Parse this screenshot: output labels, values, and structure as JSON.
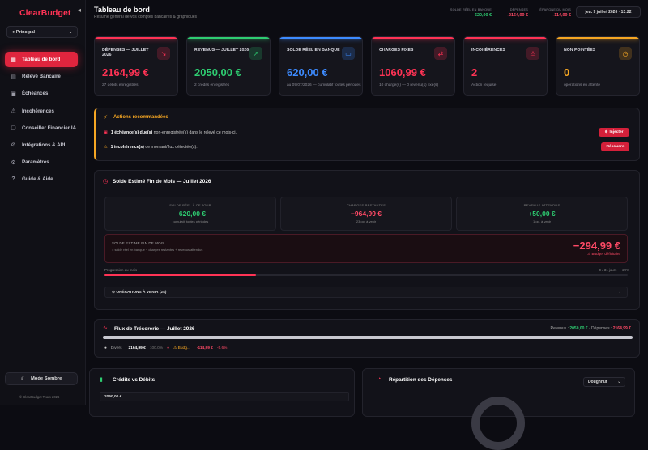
{
  "app": {
    "brand": "ClearBudget",
    "workspace": "● Principal",
    "dark_mode": "Mode Sombre",
    "copyright": "© ClearBudget Team 2026"
  },
  "nav": [
    {
      "label": "Tableau de bord",
      "icon": "grid-icon",
      "active": true
    },
    {
      "label": "Relevé Bancaire",
      "icon": "bank-icon"
    },
    {
      "label": "Échéances",
      "icon": "calendar-icon"
    },
    {
      "label": "Incohérences",
      "icon": "alert-icon"
    },
    {
      "label": "Conseiller Financier IA",
      "icon": "chat-icon"
    },
    {
      "label": "Intégrations & API",
      "icon": "link-icon"
    },
    {
      "label": "Paramètres",
      "icon": "gear-icon"
    },
    {
      "label": "Guide & Aide",
      "icon": "help-icon"
    }
  ],
  "header": {
    "title": "Tableau de bord",
    "subtitle": "Résumé général de vos comptes bancaires & graphiques",
    "stats": [
      {
        "label": "SOLDE RÉEL EN BANQUE",
        "value": "620,00 €",
        "color": "#2ecc71"
      },
      {
        "label": "DÉPENSES",
        "value": "-2164,99 €",
        "color": "#ff4a66"
      },
      {
        "label": "ÉPARGNE DU MOIS",
        "value": "-114,99 €",
        "color": "#ff4a66"
      }
    ],
    "date": "jeu. 9 juillet 2026 · 13:22"
  },
  "kpis": [
    {
      "label": "DÉPENSES — JUILLET 2026",
      "value": "2164,99 €",
      "sub": "27 débits enregistrés",
      "color": "#ff3355",
      "icon": "trend-down-icon",
      "glyph": "↘"
    },
    {
      "label": "REVENUS — JUILLET 2026",
      "value": "2050,00 €",
      "sub": "2 crédits enregistrés",
      "color": "#2ecc71",
      "icon": "trend-up-icon",
      "glyph": "↗"
    },
    {
      "label": "SOLDE RÉEL EN BANQUE",
      "value": "620,00 €",
      "sub": "au 09/07/2026 — cumulatif toutes périodes",
      "color": "#3d8bff",
      "icon": "wallet-icon",
      "glyph": "▭"
    },
    {
      "label": "CHARGES FIXES",
      "value": "1060,99 €",
      "sub": "10 charge(s) — 0 revenu(s) fixe(s)",
      "color": "#ff3355",
      "icon": "repeat-icon",
      "glyph": "⇄"
    },
    {
      "label": "INCOHÉRENCES",
      "value": "2",
      "sub": "Action requise",
      "color": "#ff3355",
      "icon": "warning-icon",
      "glyph": "⚠"
    },
    {
      "label": "NON POINTÉES",
      "value": "0",
      "sub": "opérations en attente",
      "color": "#f5a623",
      "icon": "clock-icon",
      "glyph": "◷"
    }
  ],
  "actions": {
    "title": "Actions recommandées",
    "rows": [
      {
        "bold": "1 échéance(s) due(s)",
        "text": " non-enregistrée(s) dans le relevé ce mois-ci.",
        "button": "Injecter"
      },
      {
        "bold": "1 incohérence(s)",
        "text": " de montant/flux détectée(s).",
        "button": "Résoudre"
      }
    ]
  },
  "forecast": {
    "title": "Solde Estimé Fin de Mois — Juillet 2026",
    "boxes": [
      {
        "label": "SOLDE RÉEL À CE JOUR",
        "value": "+620,00 €",
        "sub": "cumulatif toutes périodes",
        "color": "#2ecc71"
      },
      {
        "label": "CHARGES RESTANTES",
        "value": "−964,99 €",
        "sub": "23 op. à venir",
        "color": "#ff4a66"
      },
      {
        "label": "REVENUS ATTENDUS",
        "value": "+50,00 €",
        "sub": "1 op. à venir",
        "color": "#2ecc71"
      }
    ],
    "end_label": "SOLDE ESTIMÉ FIN DE MOIS",
    "end_sub": "= solde réel en banque − charges restantes + revenus attendus",
    "end_value": "−294,99 €",
    "end_warning": "⚠ Budget déficitaire",
    "progress_label": "Progression du mois",
    "progress_right": "9 / 31 jours — 29%",
    "progress_fraction": 0.29,
    "upcoming": "⊙ OPÉRATIONS À VENIR (24)"
  },
  "cashflow": {
    "title": "Flux de Trésorerie — Juillet 2026",
    "revenus_label": "Revenus :",
    "revenus_value": "2050,00 €",
    "depenses_label": "· Dépenses :",
    "depenses_value": "2164,99 €",
    "legend_name": "Divers",
    "legend_value": "2164,99 €",
    "legend_pct": "100.0%",
    "budget_label": "⚠ Budg...",
    "budget_value": "-114,99 €",
    "budget_pct": "-5.6%"
  },
  "credits": {
    "title": "Crédits vs Débits",
    "first_value": "2050,00 €"
  },
  "depenses": {
    "title": "Répartition des Dépenses",
    "select": "Doughnut"
  }
}
